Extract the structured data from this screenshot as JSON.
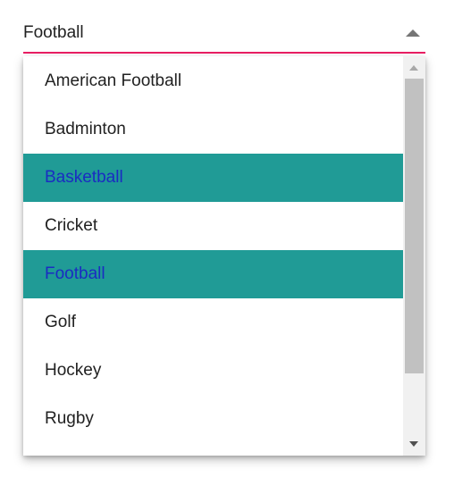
{
  "dropdown": {
    "selected_value": "Football",
    "underline_color": "#e91e63"
  },
  "list": {
    "items": [
      {
        "label": "American Football",
        "selected": false
      },
      {
        "label": "Badminton",
        "selected": false
      },
      {
        "label": "Basketball",
        "selected": true
      },
      {
        "label": "Cricket",
        "selected": false
      },
      {
        "label": "Football",
        "selected": true
      },
      {
        "label": "Golf",
        "selected": false
      },
      {
        "label": "Hockey",
        "selected": false
      },
      {
        "label": "Rugby",
        "selected": false
      }
    ],
    "selected_bg_color": "#209b96",
    "selected_text_color": "#1a2cc2"
  },
  "icons": {
    "caret": "caret-up-icon",
    "scroll_up": "scroll-up-arrow-icon",
    "scroll_down": "scroll-down-arrow-icon"
  }
}
